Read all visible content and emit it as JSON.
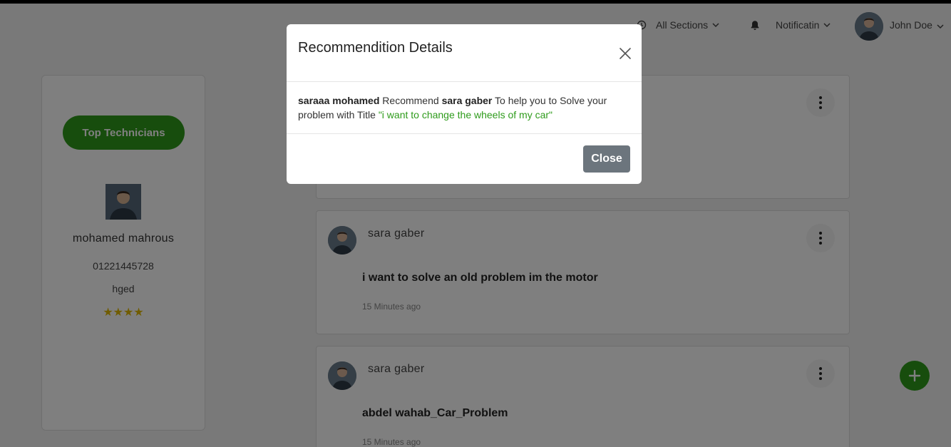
{
  "nav": {
    "sections_label": "All Sections",
    "notifications_label": "Notificatin",
    "user_name": "John Doe"
  },
  "sidebar": {
    "button_label": "Top Technicians",
    "technician": {
      "name": "mohamed mahrous",
      "phone": "01221445728",
      "city": "hged",
      "stars": "★★★★",
      "rating": 4
    }
  },
  "posts": [
    {
      "author": "",
      "title": "",
      "time": ""
    },
    {
      "author": "sara gaber",
      "title": "i want to solve an old problem im the motor",
      "time": "15 Minutes ago"
    },
    {
      "author": "sara gaber",
      "title": "abdel wahab_Car_Problem",
      "time": "15 Minutes ago"
    }
  ],
  "modal": {
    "title": "Recommendition Details",
    "recommender": "saraaa mohamed",
    "verb": " Recommend ",
    "recommended": "sara gaber",
    "middle": " To help you to Solve your problem with Title ",
    "problem_title": "\"i want to change the wheels of my car\"",
    "close_label": "Close"
  },
  "colors": {
    "accent": "#2e9b1b",
    "close_button": "#6c757d",
    "star": "#e0b800"
  }
}
